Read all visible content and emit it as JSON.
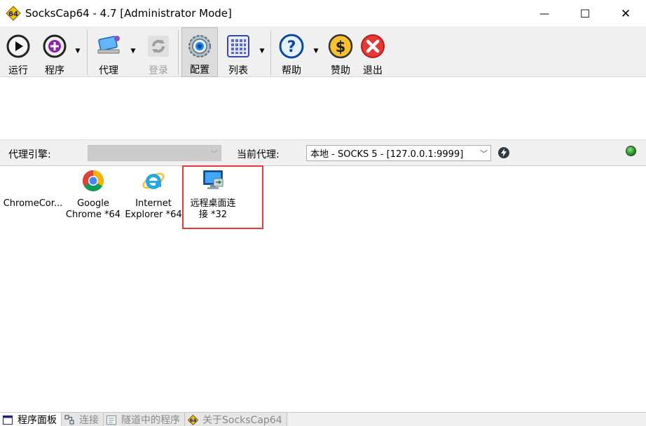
{
  "window": {
    "title": "SocksCap64 - 4.7 [Administrator Mode]",
    "app_icon_text": "64",
    "minimize": "—",
    "maximize": "☐",
    "close": "✕"
  },
  "toolbar": {
    "run": "运行",
    "program": "程序",
    "proxy": "代理",
    "login": "登录",
    "config": "配置",
    "list": "列表",
    "help": "帮助",
    "donate": "赞助",
    "exit": "退出"
  },
  "proxybar": {
    "engine_label": "代理引擎:",
    "engine_value": "",
    "current_label": "当前代理:",
    "current_value": "本地 - SOCKS 5 - [127.0.0.1:9999]"
  },
  "programs": [
    {
      "line1": "ChromeCor...",
      "line2": "",
      "icon": "app-icon"
    },
    {
      "line1": "Google",
      "line2": "Chrome *64",
      "icon": "chrome-icon"
    },
    {
      "line1": "Internet",
      "line2": "Explorer *64",
      "icon": "ie-icon"
    },
    {
      "line1": "远程桌面连",
      "line2": "接 *32",
      "icon": "remote-desktop-icon"
    }
  ],
  "tabs": [
    {
      "label": "程序面板",
      "active": true
    },
    {
      "label": "连接",
      "active": false
    },
    {
      "label": "隧道中的程序",
      "active": false
    },
    {
      "label": "关于SocksCap64",
      "active": false
    }
  ],
  "colors": {
    "highlight": "#e53935",
    "status_led": "#1a8a1a"
  }
}
